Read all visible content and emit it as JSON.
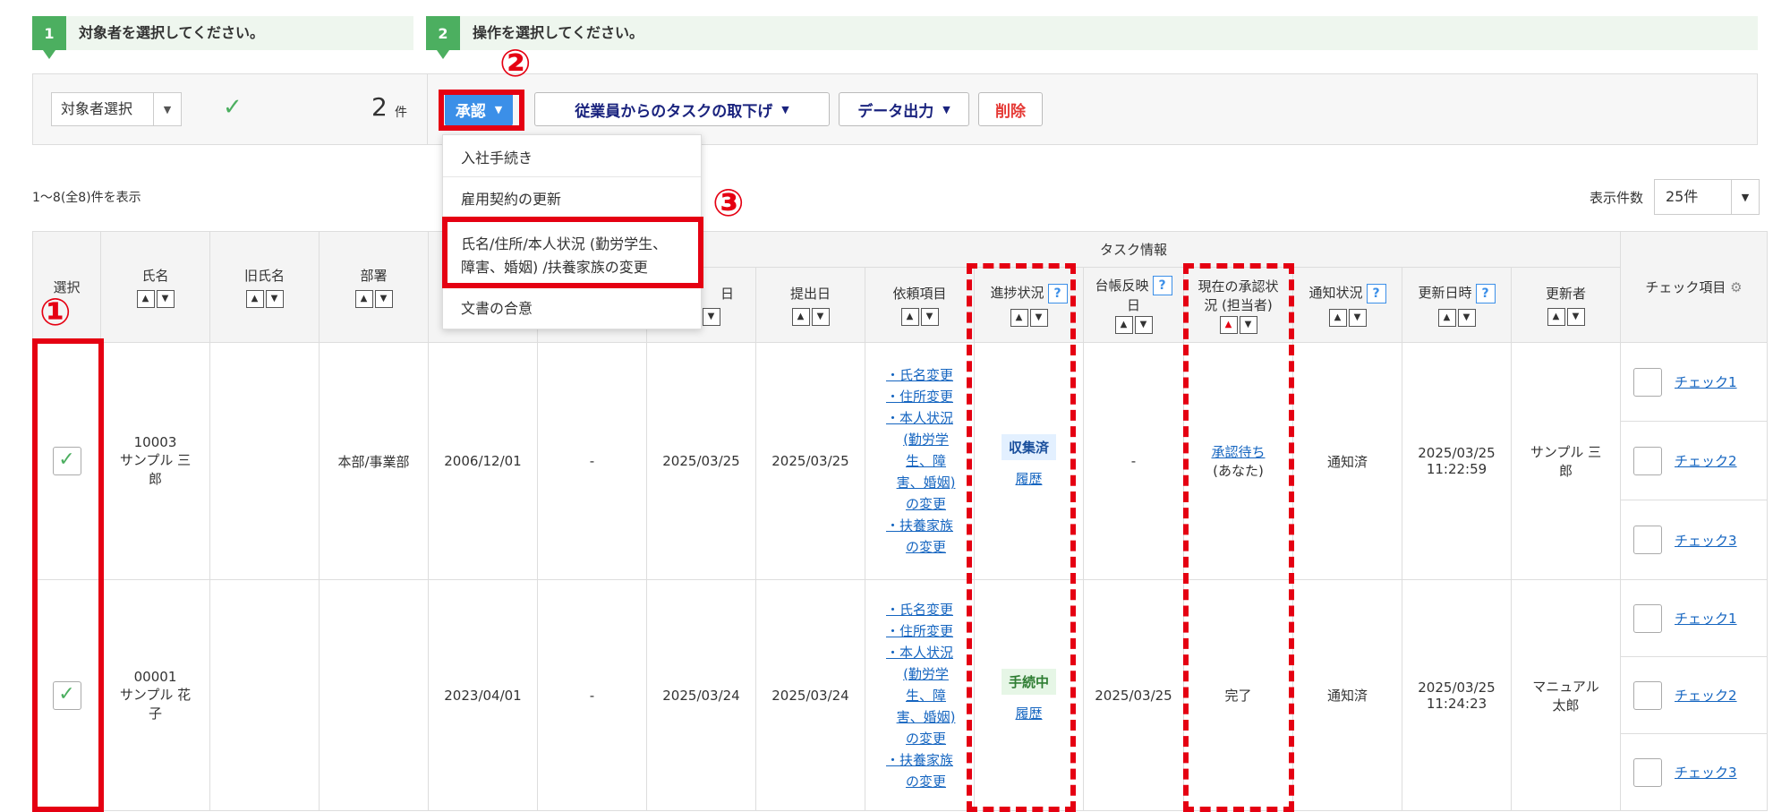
{
  "steps": [
    {
      "num": "1",
      "label": "対象者を選択してください。"
    },
    {
      "num": "2",
      "label": "操作を選択してください。"
    }
  ],
  "toolbar": {
    "target_select": "対象者選択",
    "selected_count": "2",
    "count_unit": "件",
    "approve": "承認",
    "withdraw": "従業員からのタスクの取下げ",
    "export": "データ出力",
    "delete": "削除"
  },
  "dropdown": {
    "items": [
      "入社手続き",
      "雇用契約の更新",
      "氏名/住所/本人状況 (勤労学生、",
      "障害、婚姻) /扶養家族の変更",
      "文書の合意"
    ]
  },
  "annotations": [
    "①",
    "②",
    "③"
  ],
  "list_info": "1～8(全8)件を表示",
  "per_page": {
    "label": "表示件数",
    "value": "25件"
  },
  "table": {
    "group_header": "タスク情報",
    "headers": {
      "select": "選択",
      "name": "氏名",
      "old_name": "旧氏名",
      "dept": "部署",
      "col_hire_partial": "日",
      "submitted": "提出日",
      "request_items": "依頼項目",
      "progress": "進捗状況",
      "ledger_1": "台帳反映",
      "ledger_2": "日",
      "approval_1": "現在の承認状",
      "approval_2": "況 (担当者)",
      "notify": "通知状況",
      "updated": "更新日時",
      "updater": "更新者",
      "check_items": "チェック項目"
    },
    "rows": [
      {
        "emp_no": "10003",
        "name_1": "サンプル 三",
        "name_2": "郎",
        "old_name": "",
        "dept": "本部/事業部",
        "date1": "2006/12/01",
        "date2": "-",
        "date3": "2025/03/25",
        "submitted": "2025/03/25",
        "request_items": [
          "・氏名変更",
          "・住所変更",
          "・本人状況",
          "(勤労学",
          "生、障",
          "害、婚姻)",
          "の変更",
          "・扶養家族",
          "の変更"
        ],
        "progress": "収集済",
        "history": "履歴",
        "ledger": "-",
        "approval_1": "承認待ち",
        "approval_2": "(あなた)",
        "notify": "通知済",
        "updated_1": "2025/03/25",
        "updated_2": "11:22:59",
        "updater_1": "サンプル 三",
        "updater_2": "郎",
        "checks": [
          "チェック1",
          "チェック2",
          "チェック3"
        ]
      },
      {
        "emp_no": "00001",
        "name_1": "サンプル 花",
        "name_2": "子",
        "old_name": "",
        "dept": "",
        "date1": "2023/04/01",
        "date2": "-",
        "date3": "2025/03/24",
        "submitted": "2025/03/24",
        "request_items": [
          "・氏名変更",
          "・住所変更",
          "・本人状況",
          "(勤労学",
          "生、障",
          "害、婚姻)",
          "の変更",
          "・扶養家族",
          "の変更"
        ],
        "progress": "手続中",
        "history": "履歴",
        "ledger": "2025/03/25",
        "approval_1": "完了",
        "approval_2": "",
        "notify": "通知済",
        "updated_1": "2025/03/25",
        "updated_2": "11:24:23",
        "updater_1": "マニュアル",
        "updater_2": "太郎",
        "checks": [
          "チェック1",
          "チェック2",
          "チェック3"
        ]
      }
    ]
  }
}
